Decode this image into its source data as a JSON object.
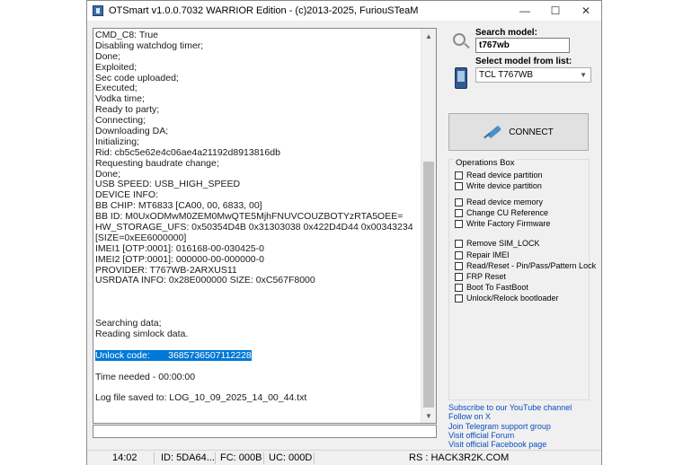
{
  "window": {
    "title": "OTSmart  v1.0.0.7032 WARRIOR Edition - (c)2013-2025, FuriouSTeaM",
    "minimize": "—",
    "maximize": "☐",
    "close": "✕"
  },
  "log": {
    "lines": [
      "CMD_C8: True",
      "Disabling watchdog timer;",
      "Done;",
      "Exploited;",
      "Sec code uploaded;",
      "Executed;",
      "Vodka time;",
      "Ready to party;",
      "Connecting;",
      "Downloading DA;",
      "Initializing;",
      "Rid: cb5c5e62e4c06ae4a21192d8913816db",
      "Requesting baudrate change;",
      "Done;",
      "USB SPEED: USB_HIGH_SPEED",
      "DEVICE INFO:",
      "BB CHIP: MT6833 [CA00, 00, 6833, 00]",
      "BB ID: M0UxODMwM0ZEM0MwQTE5MjhFNUVCOUZBOTYzRTA5OEE=",
      "HW_STORAGE_UFS: 0x50354D4B 0x31303038 0x422D4D44 0x00343234",
      "[SIZE=0xEE6000000]",
      "IMEI1 [OTP:0001]: 016168-00-030425-0",
      "IMEI2 [OTP:0001]: 000000-00-000000-0",
      "PROVIDER: T767WB-2ARXUS11",
      "USRDATA INFO: 0x28E000000 SIZE: 0xC567F8000",
      "",
      "",
      "",
      "Searching data;",
      "Reading simlock data.",
      "",
      "Unlock code:       3685736507112228",
      "",
      "Time needed - 00:00:00",
      "",
      "Log file saved to: LOG_10_09_2025_14_00_44.txt"
    ],
    "highlight_index": 30
  },
  "search": {
    "label": "Search model:",
    "value": "t767wb"
  },
  "model": {
    "label": "Select model from list:",
    "selected": "TCL T767WB"
  },
  "connect": {
    "label": "CONNECT"
  },
  "operations": {
    "title": "Operations Box",
    "items": [
      "Read device partition",
      "Write device partition",
      "Read device memory",
      "Change CU Reference",
      "Write Factory Firmware",
      "Remove SIM_LOCK",
      "Repair IMEI",
      "Read/Reset - Pin/Pass/Pattern Lock",
      "FRP Reset",
      "Boot To FastBoot",
      "Unlock/Relock bootloader"
    ]
  },
  "links": [
    "Subscribe to our YouTube channel",
    "Follow on X",
    "Join Telegram support group",
    "Visit official Forum",
    "Visit official Facebook page"
  ],
  "status": {
    "time": "14:02",
    "id": "ID: 5DA64...",
    "fc": "FC: 000B",
    "uc": "UC: 000D",
    "rs": "RS : HACK3R2K.COM"
  },
  "colors": {
    "highlight": "#0078d7",
    "link": "#0b4dbf",
    "window_bg": "#f0f0f0"
  },
  "icons": {
    "search": "magnifier-icon",
    "model": "phone-icon",
    "connect": "usb-plug-icon"
  }
}
